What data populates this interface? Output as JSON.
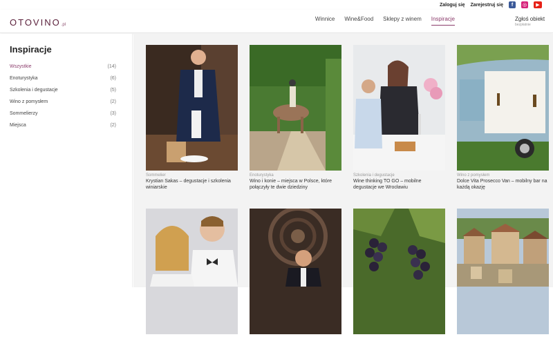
{
  "topbar": {
    "login": "Zaloguj się",
    "register": "Zarejestruj się",
    "social": [
      {
        "name": "facebook-icon",
        "glyph": "f"
      },
      {
        "name": "instagram-icon",
        "glyph": "◎"
      },
      {
        "name": "youtube-icon",
        "glyph": "▶"
      }
    ]
  },
  "header": {
    "logo": "OTOVINO",
    "logo_suffix": ".pl",
    "nav": [
      "Winnice",
      "Wine&Food",
      "Sklepy z winem",
      "Inspiracje"
    ],
    "active_nav": "Inspiracje",
    "report_title": "Zgłoś obiekt",
    "report_sub": "bezpłatnie"
  },
  "sidebar": {
    "title": "Inspiracje",
    "categories": [
      {
        "label": "Wszystkie",
        "count": "(14)",
        "active": true
      },
      {
        "label": "Enoturystyka",
        "count": "(6)"
      },
      {
        "label": "Szkolenia i degustacje",
        "count": "(5)"
      },
      {
        "label": "Wino z pomysłem",
        "count": "(2)"
      },
      {
        "label": "Sommelierzy",
        "count": "(3)"
      },
      {
        "label": "Miejsca",
        "count": "(2)"
      }
    ]
  },
  "cards": [
    {
      "category": "Sommelier",
      "title": "Krystian Sakas – degustacje i szkolenia winiarskie"
    },
    {
      "category": "Enoturystyka",
      "title": "Wino i konie – miejsca w Polsce, które połączyły te dwie dziedziny"
    },
    {
      "category": "Szkolenia i degustacje",
      "title": "Wine thinking TO GO – mobilne degustacje we Wrocławiu"
    },
    {
      "category": "Wino z pomysłem",
      "title": "Dolce Vita Prosecco Van – mobilny bar na każdą okazję"
    },
    {
      "category": "",
      "title": ""
    },
    {
      "category": "",
      "title": ""
    },
    {
      "category": "",
      "title": ""
    },
    {
      "category": "",
      "title": ""
    }
  ],
  "colors": {
    "accent": "#8a3a6a",
    "logo": "#5a1f3a",
    "content_bg": "#f3f3f3"
  }
}
